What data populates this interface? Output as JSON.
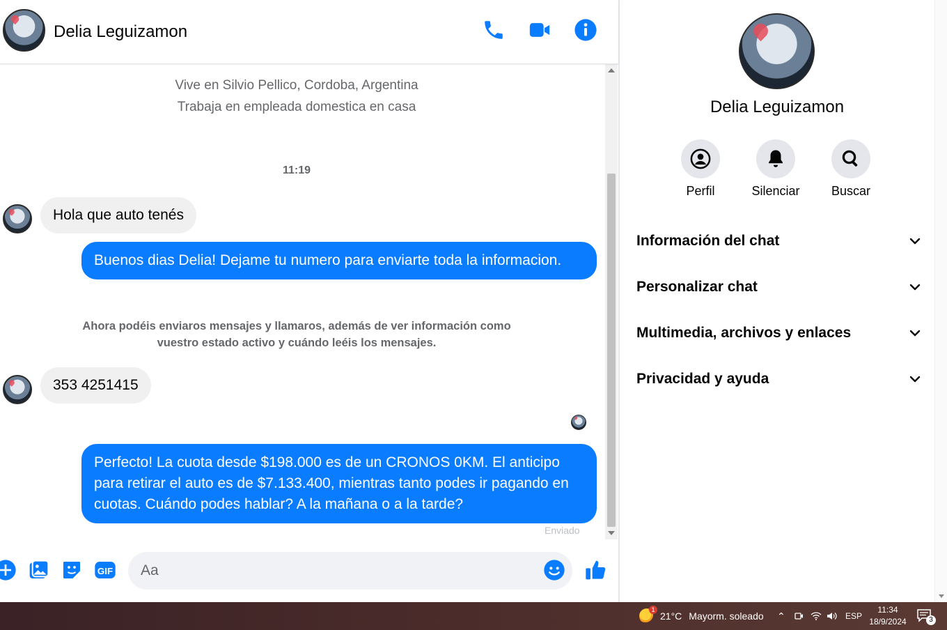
{
  "header": {
    "name": "Delia Leguizamon",
    "icons": [
      "phone-icon",
      "video-camera-icon",
      "info-icon"
    ]
  },
  "profile_info": {
    "lives_in": "Vive en Silvio Pellico, Cordoba, Argentina",
    "works_at": "Trabaja en empleada domestica en casa"
  },
  "conversation": {
    "timestamp": "11:19",
    "messages": [
      {
        "from": "them",
        "text": "Hola que auto tenés"
      },
      {
        "from": "me",
        "text": "Buenos dias Delia! Dejame tu numero para enviarte toda la informacion."
      },
      {
        "from": "system",
        "text": "Ahora podéis enviaros mensajes y llamaros, además de ver información como vuestro estado activo y cuándo leéis los mensajes."
      },
      {
        "from": "them",
        "text": "353 4251415"
      },
      {
        "from": "me",
        "text": "Perfecto! La cuota desde $198.000 es de un CRONOS 0KM. El anticipo para retirar el auto es de $7.133.400, mientras tanto podes ir pagando en cuotas. Cuándo podes hablar? A la mañana o a la tarde?"
      }
    ],
    "status": "Enviado"
  },
  "composer": {
    "placeholder": "Aa",
    "icons": [
      "plus-icon",
      "image-icon",
      "sticker-icon",
      "gif-icon",
      "emoji-icon",
      "thumbs-up-icon"
    ],
    "gif_label": "GIF"
  },
  "side_panel": {
    "name": "Delia Leguizamon",
    "actions": [
      {
        "label": "Perfil",
        "icon": "profile-icon"
      },
      {
        "label": "Silenciar",
        "icon": "bell-icon"
      },
      {
        "label": "Buscar",
        "icon": "search-icon"
      }
    ],
    "sections": [
      {
        "label": "Información del chat"
      },
      {
        "label": "Personalizar chat"
      },
      {
        "label": "Multimedia, archivos y enlaces"
      },
      {
        "label": "Privacidad y ayuda"
      }
    ]
  },
  "taskbar": {
    "weather_temp": "21°C",
    "weather_desc": "Mayorm. soleado",
    "weather_badge": "1",
    "language": "ESP",
    "time": "11:34",
    "date": "18/9/2024",
    "notifications": "3"
  },
  "colors": {
    "accent": "#0a7cff",
    "bubble_in": "#f0f0f0",
    "text_secondary": "#65676b"
  }
}
